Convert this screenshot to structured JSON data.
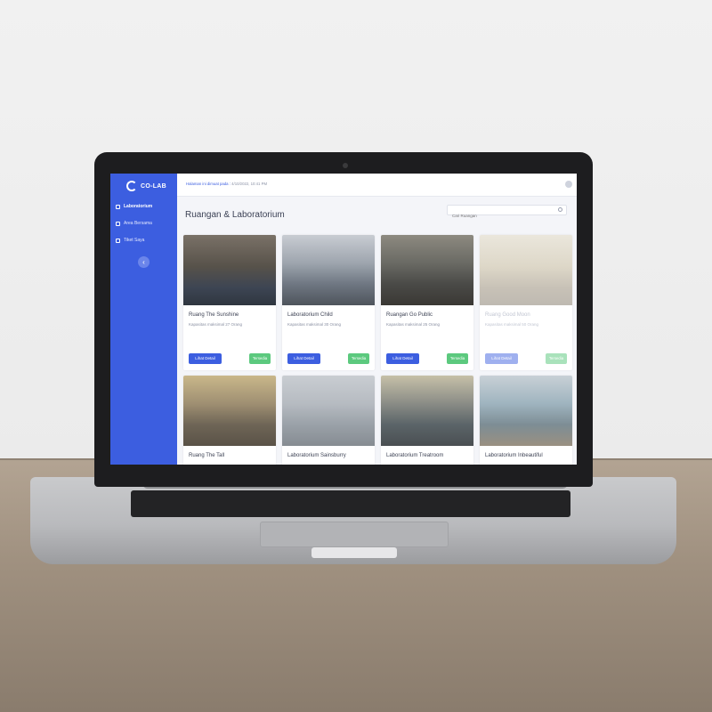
{
  "app": {
    "logo_text": "CO-LAB",
    "accent_color": "#3c5ee0",
    "success_color": "#5cc97e"
  },
  "sidebar": {
    "items": [
      {
        "label": "Laboratorium",
        "icon": "lab-icon",
        "active": true
      },
      {
        "label": "Area Bersama",
        "icon": "area-icon",
        "active": false
      },
      {
        "label": "Tiket Saya",
        "icon": "ticket-icon",
        "active": false
      }
    ],
    "collapse_glyph": "‹"
  },
  "header": {
    "visit_label": "Halaman ini dimuat pada :",
    "visit_time": "4/10/2022, 10:41 PM"
  },
  "main": {
    "title": "Ruangan & Laboratorium",
    "search_placeholder": "Cari Ruangan"
  },
  "cards": [
    {
      "name": "Ruang The Sunshine",
      "capacity": "Kapasitas maksimal 27 Orang",
      "button": "Lihat Detail",
      "status": "Tersedia"
    },
    {
      "name": "Laboratorium Child",
      "capacity": "Kapasitas maksimal 30 Orang",
      "button": "Lihat Detail",
      "status": "Tersedia"
    },
    {
      "name": "Ruangan Go Public",
      "capacity": "Kapasitas maksimal 25 Orang",
      "button": "Lihat Detail",
      "status": "Tersedia"
    },
    {
      "name": "Ruang Good Moon",
      "capacity": "Kapasitas maksimal 50 Orang",
      "button": "Lihat Detail",
      "status": "Tersedia"
    },
    {
      "name": "Ruang The Tall",
      "capacity": "",
      "button": "",
      "status": ""
    },
    {
      "name": "Laboratorium Sainsburry",
      "capacity": "",
      "button": "",
      "status": ""
    },
    {
      "name": "Laboratorium Treatroom",
      "capacity": "",
      "button": "",
      "status": ""
    },
    {
      "name": "Laboratorium Inbeautiful",
      "capacity": "",
      "button": "",
      "status": ""
    }
  ]
}
